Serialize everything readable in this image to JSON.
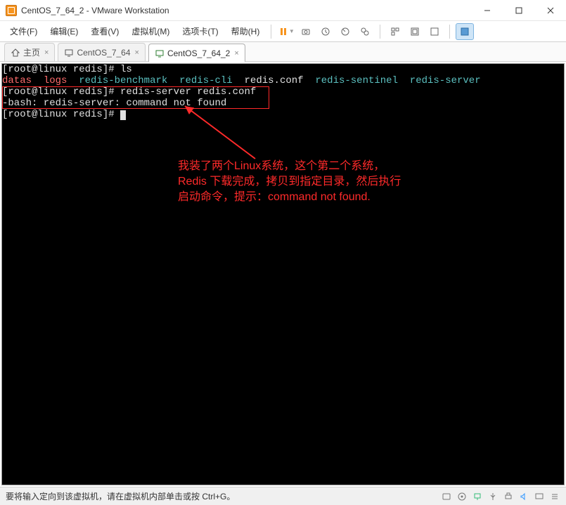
{
  "window": {
    "title": "CentOS_7_64_2 - VMware Workstation"
  },
  "menu": {
    "file": "文件(F)",
    "edit": "编辑(E)",
    "view": "查看(V)",
    "vm": "虚拟机(M)",
    "tabs": "选项卡(T)",
    "help": "帮助(H)"
  },
  "tabs": {
    "home": "主页",
    "t1": "CentOS_7_64",
    "t2": "CentOS_7_64_2"
  },
  "terminal": {
    "l1_prompt": "[root@linux redis]# ",
    "l1_cmd": "ls",
    "l2_datas": "datas",
    "l2_sp1": "  ",
    "l2_logs": "logs",
    "l2_sp2": "  ",
    "l2_bench": "redis-benchmark",
    "l2_sp3": "  ",
    "l2_cli": "redis-cli",
    "l2_sp4": "  ",
    "l2_conf": "redis.conf",
    "l2_sp5": "  ",
    "l2_sent": "redis-sentinel",
    "l2_sp6": "  ",
    "l2_serv": "redis-server",
    "l3_prompt": "[root@linux redis]# ",
    "l3_cmd": "redis-server redis.conf",
    "l4": "-bash: redis-server: command not found",
    "l5_prompt": "[root@linux redis]# "
  },
  "annotation": {
    "a1": "我装了两个Linux系统，这个第二个系统，",
    "a2": "Redis 下载完成，拷贝到指定目录，然后执行",
    "a3": "启动命令，提示：command not found."
  },
  "status": {
    "text": "要将输入定向到该虚拟机，请在虚拟机内部单击或按 Ctrl+G。"
  }
}
